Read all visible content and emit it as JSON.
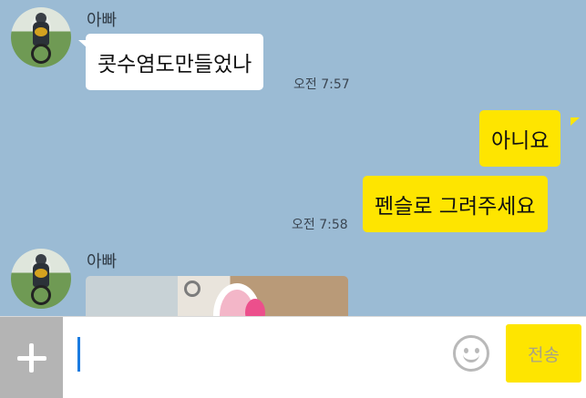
{
  "messages": [
    {
      "sender": "아빠",
      "text": "콧수염도만들었나",
      "time": "오전 7:57"
    },
    {
      "text": "아니요"
    },
    {
      "text": "펜슬로 그려주세요",
      "time": "오전 7:58"
    },
    {
      "sender": "아빠",
      "attachment": "photo"
    }
  ],
  "composer": {
    "input_value": "",
    "send_label": "전송",
    "plus_icon": "plus-icon",
    "emoji_icon": "emoticon-icon"
  },
  "colors": {
    "chat_background": "#9bbbd4",
    "incoming_bubble": "#ffffff",
    "outgoing_bubble": "#fee500",
    "send_button": "#fee500",
    "caret": "#1a7be0"
  }
}
